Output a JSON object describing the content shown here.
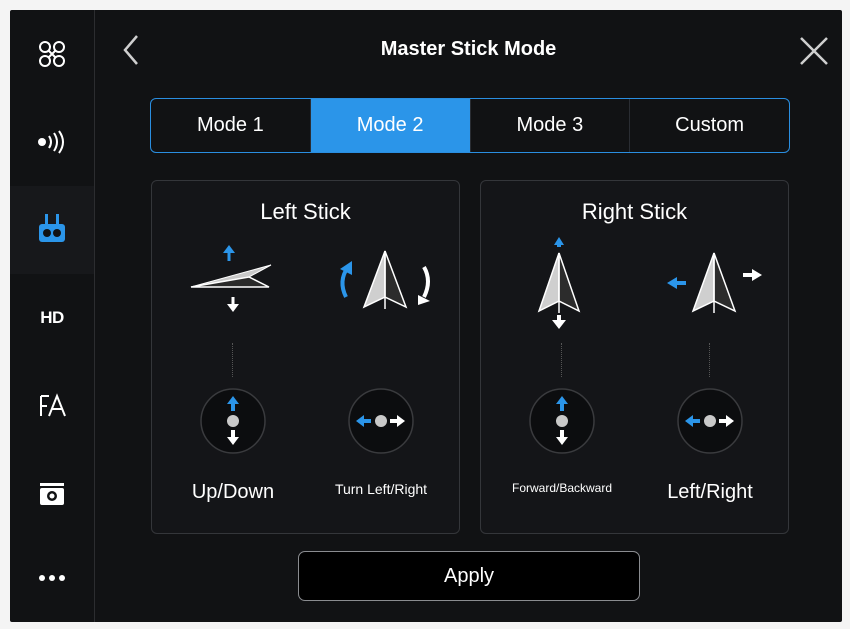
{
  "header": {
    "title": "Master Stick Mode"
  },
  "sidebar": {
    "items": [
      {
        "icon": "drone-icon"
      },
      {
        "icon": "signal-icon"
      },
      {
        "icon": "remote-controller-icon",
        "active": true
      },
      {
        "label": "HD"
      },
      {
        "icon": "display-icon"
      },
      {
        "icon": "camera-icon"
      },
      {
        "icon": "more-icon"
      }
    ]
  },
  "tabs": [
    "Mode 1",
    "Mode 2",
    "Mode 3",
    "Custom"
  ],
  "active_tab": "Mode 2",
  "left_stick": {
    "title": "Left Stick",
    "up_down_label": "Up/Down",
    "turn_label": "Turn Left/Right"
  },
  "right_stick": {
    "title": "Right Stick",
    "forward_label": "Forward/Backward",
    "left_right_label": "Left/Right"
  },
  "apply_label": "Apply",
  "colors": {
    "accent": "#2b95e9",
    "background": "#111214",
    "panel_border": "#34363a"
  }
}
